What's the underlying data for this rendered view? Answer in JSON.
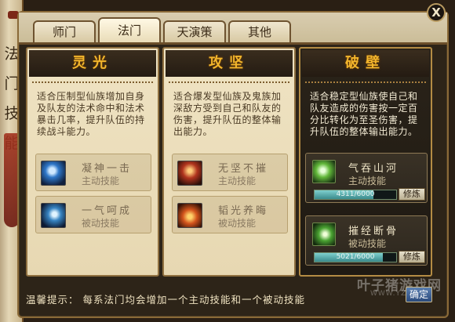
{
  "window": {
    "side_banner": "法门技能",
    "close_label": "X"
  },
  "tabs": [
    {
      "label": "师门",
      "active": false
    },
    {
      "label": "法门",
      "active": true
    },
    {
      "label": "天演策",
      "active": false
    },
    {
      "label": "其他",
      "active": false
    }
  ],
  "cards": [
    {
      "title": "灵光",
      "description": "适合压制型仙族增加自身及队友的法术命中和法术暴击几率，提升队伍的持续战斗能力。",
      "skills": [
        {
          "name": "凝神一击",
          "type": "主动技能",
          "icon": "blue-energy-icon"
        },
        {
          "name": "一气呵成",
          "type": "被动技能",
          "icon": "blue-wave-icon"
        }
      ]
    },
    {
      "title": "攻坚",
      "description": "适合爆发型仙族及鬼族加深敌方受到自己和队友的伤害，提升队伍的整体输出能力。",
      "skills": [
        {
          "name": "无坚不摧",
          "type": "主动技能",
          "icon": "red-warrior-icon"
        },
        {
          "name": "韬光养晦",
          "type": "被动技能",
          "icon": "red-flame-icon"
        }
      ]
    },
    {
      "title": "破壁",
      "description": "适合稳定型仙族使自己和队友造成的伤害按一定百分比转化为至圣伤害，提升队伍的整体输出能力。",
      "skills": [
        {
          "name": "气吞山河",
          "type": "主动技能",
          "icon": "green-mountain-icon",
          "progress_text": "4311/6000",
          "progress": 0.7185,
          "train_label": "修炼"
        },
        {
          "name": "摧经断骨",
          "type": "被动技能",
          "icon": "green-claw-icon",
          "progress_text": "5021/6000",
          "progress": 0.8368,
          "train_label": "修炼"
        }
      ]
    }
  ],
  "footer": {
    "tip": "温馨提示：  每系法门均会增加一个主动技能和一个被动技能",
    "confirm_label": "确定"
  },
  "watermark": {
    "text": "叶子猪游戏网",
    "url_text": "WWW.YZZ.CN"
  },
  "colors": {
    "title_gold": "#f2b52c",
    "panel_dark": "#2d2418",
    "progress_teal": "#3b8b8c"
  }
}
